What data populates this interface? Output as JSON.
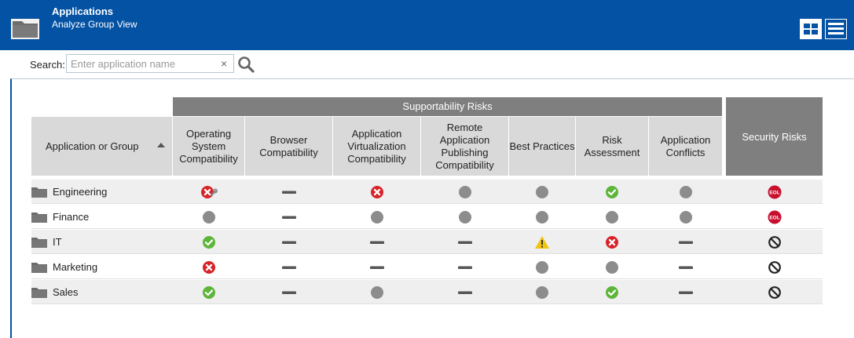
{
  "header": {
    "title": "Applications",
    "subtitle": "Analyze Group View",
    "bg_color": "#0452a3"
  },
  "search": {
    "label": "Search:",
    "placeholder": "Enter application name",
    "value": ""
  },
  "table": {
    "group_header": "Supportability Risks",
    "app_column": "Application or Group",
    "sort_direction": "ascending",
    "columns": [
      "Operating System Compatibility",
      "Browser Compatibility",
      "Application Virtualization Compatibility",
      "Remote Application Publishing Compatibility",
      "Best Practices",
      "Risk Assessment",
      "Application Conflicts"
    ],
    "security_column": "Security Risks",
    "rows": [
      {
        "name": "Engineering",
        "cells": [
          "error-wrench",
          "dash",
          "error",
          "gray",
          "gray",
          "ok",
          "gray"
        ],
        "security": "eol"
      },
      {
        "name": "Finance",
        "cells": [
          "gray",
          "dash",
          "gray",
          "gray",
          "gray",
          "gray",
          "gray"
        ],
        "security": "eol"
      },
      {
        "name": "IT",
        "cells": [
          "ok",
          "dash",
          "dash",
          "dash",
          "warning",
          "error",
          "dash"
        ],
        "security": "none"
      },
      {
        "name": "Marketing",
        "cells": [
          "error",
          "dash",
          "dash",
          "dash",
          "gray",
          "gray",
          "dash"
        ],
        "security": "none"
      },
      {
        "name": "Sales",
        "cells": [
          "ok",
          "dash",
          "gray",
          "dash",
          "gray",
          "ok",
          "dash"
        ],
        "security": "none"
      }
    ]
  },
  "status_colors": {
    "ok": "#5db53a",
    "error": "#d72329",
    "eol": "#c8102e",
    "warning": "#f1c40f",
    "gray": "#8c8c8c",
    "dash": "#555555"
  },
  "icons": {
    "ok": "check-circle-icon",
    "error": "x-circle-icon",
    "error-wrench": "x-circle-wrench-icon",
    "gray": "gray-dot-icon",
    "dash": "dash-icon",
    "warning": "warning-triangle-icon",
    "eol": "eol-badge-icon",
    "none": "no-entry-icon"
  }
}
